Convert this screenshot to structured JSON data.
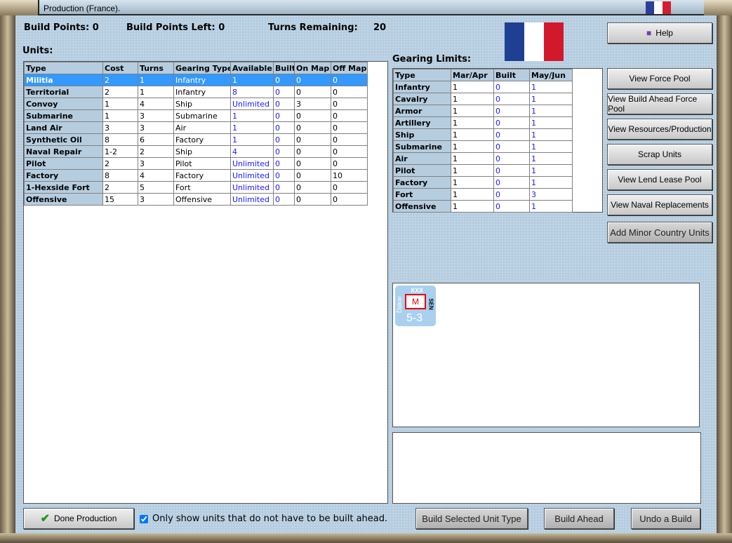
{
  "window": {
    "title": "Production (France)."
  },
  "header": {
    "build_points": "Build Points: 0",
    "build_points_left": "Build Points Left: 0",
    "turns_remaining_label": "Turns Remaining:",
    "turns_remaining": "20"
  },
  "units": {
    "label": "Units:",
    "columns": [
      "Type",
      "Cost",
      "Turns",
      "Gearing Type",
      "Available",
      "Built",
      "On Map",
      "Off Map"
    ],
    "rows": [
      [
        "Militia",
        "2",
        "1",
        "Infantry",
        "1",
        "0",
        "0",
        "0"
      ],
      [
        "Territorial",
        "2",
        "1",
        "Infantry",
        "8",
        "0",
        "0",
        "0"
      ],
      [
        "Convoy",
        "1",
        "4",
        "Ship",
        "Unlimited",
        "0",
        "3",
        "0"
      ],
      [
        "Submarine",
        "1",
        "3",
        "Submarine",
        "1",
        "0",
        "0",
        "0"
      ],
      [
        "Land Air",
        "3",
        "3",
        "Air",
        "1",
        "0",
        "0",
        "0"
      ],
      [
        "Synthetic Oil",
        "8",
        "6",
        "Factory",
        "1",
        "0",
        "0",
        "0"
      ],
      [
        "Naval Repair",
        "1-2",
        "2",
        "Ship",
        "4",
        "0",
        "0",
        "0"
      ],
      [
        "Pilot",
        "2",
        "3",
        "Pilot",
        "Unlimited",
        "0",
        "0",
        "0"
      ],
      [
        "Factory",
        "8",
        "4",
        "Factory",
        "Unlimited",
        "0",
        "0",
        "10"
      ],
      [
        "1-Hexside Fort",
        "2",
        "5",
        "Fort",
        "Unlimited",
        "0",
        "0",
        "0"
      ],
      [
        "Offensive",
        "15",
        "3",
        "Offensive",
        "Unlimited",
        "0",
        "0",
        "0"
      ]
    ]
  },
  "gearing": {
    "label": "Gearing Limits:",
    "columns": [
      "Type",
      "Mar/Apr",
      "Built",
      "May/Jun"
    ],
    "rows": [
      [
        "Infantry",
        "1",
        "0",
        "1"
      ],
      [
        "Cavalry",
        "1",
        "0",
        "1"
      ],
      [
        "Armor",
        "1",
        "0",
        "1"
      ],
      [
        "Artillery",
        "1",
        "0",
        "1"
      ],
      [
        "Ship",
        "1",
        "0",
        "1"
      ],
      [
        "Submarine",
        "1",
        "0",
        "1"
      ],
      [
        "Air",
        "1",
        "0",
        "1"
      ],
      [
        "Pilot",
        "1",
        "0",
        "1"
      ],
      [
        "Factory",
        "1",
        "0",
        "1"
      ],
      [
        "Fort",
        "1",
        "0",
        "3"
      ],
      [
        "Offensive",
        "1",
        "0",
        "1"
      ]
    ]
  },
  "buttons": {
    "help": "Help",
    "force_pool": "View Force Pool",
    "build_ahead_pool": "View Build Ahead Force Pool",
    "resources": "View Resources/Production",
    "scrap": "Scrap Units",
    "lend_lease": "View Lend Lease Pool",
    "naval_repl": "View Naval Replacements",
    "minor": "Add Minor Country Units",
    "done": "Done Production",
    "build_selected": "Build Selected Unit Type",
    "build_ahead": "Build Ahead",
    "undo": "Undo a Build"
  },
  "checkbox": {
    "label": "Only show units that do not have to be built ahead.",
    "checked": true
  },
  "counter": {
    "size": "XXX",
    "name": "Dakar",
    "letter": "M",
    "nation": "SEN",
    "strength": "5-3"
  },
  "flag": {
    "colors": [
      "#1f3f93",
      "#ffffff",
      "#d2182b"
    ]
  }
}
